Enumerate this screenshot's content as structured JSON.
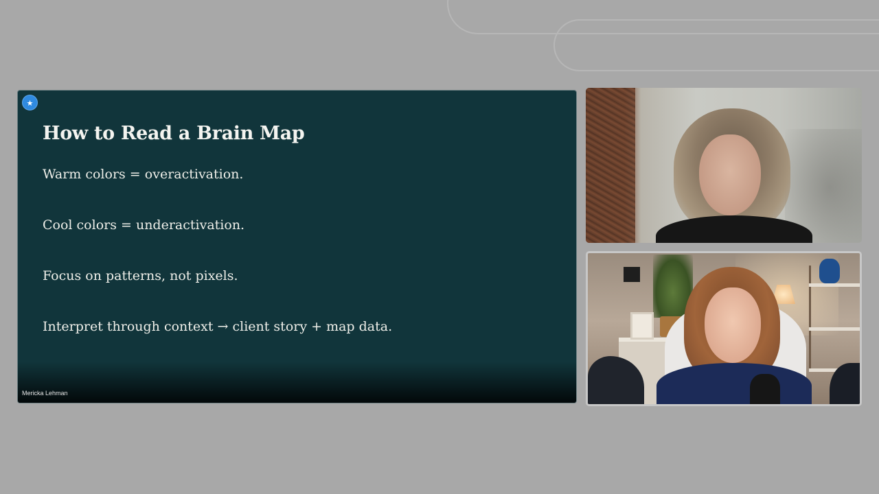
{
  "slide": {
    "title": "How to Read a Brain Map",
    "bullets": [
      "Warm colors = overactivation.",
      "Cool colors = underactivation.",
      "Focus on patterns, not pixels.",
      "Interpret through context → client story + map data."
    ],
    "speaker_name": "Mericka Lehman",
    "spotlight_icon": "star-icon",
    "spotlight_glyph": "★"
  },
  "participants": [
    {
      "role": "participant-video",
      "label": ""
    },
    {
      "role": "participant-video",
      "label": ""
    }
  ],
  "colors": {
    "background": "#a8a8a8",
    "slide_background": "#11353b",
    "slide_text": "#f0f0ea",
    "spotlight_badge": "#2f8ae0"
  }
}
